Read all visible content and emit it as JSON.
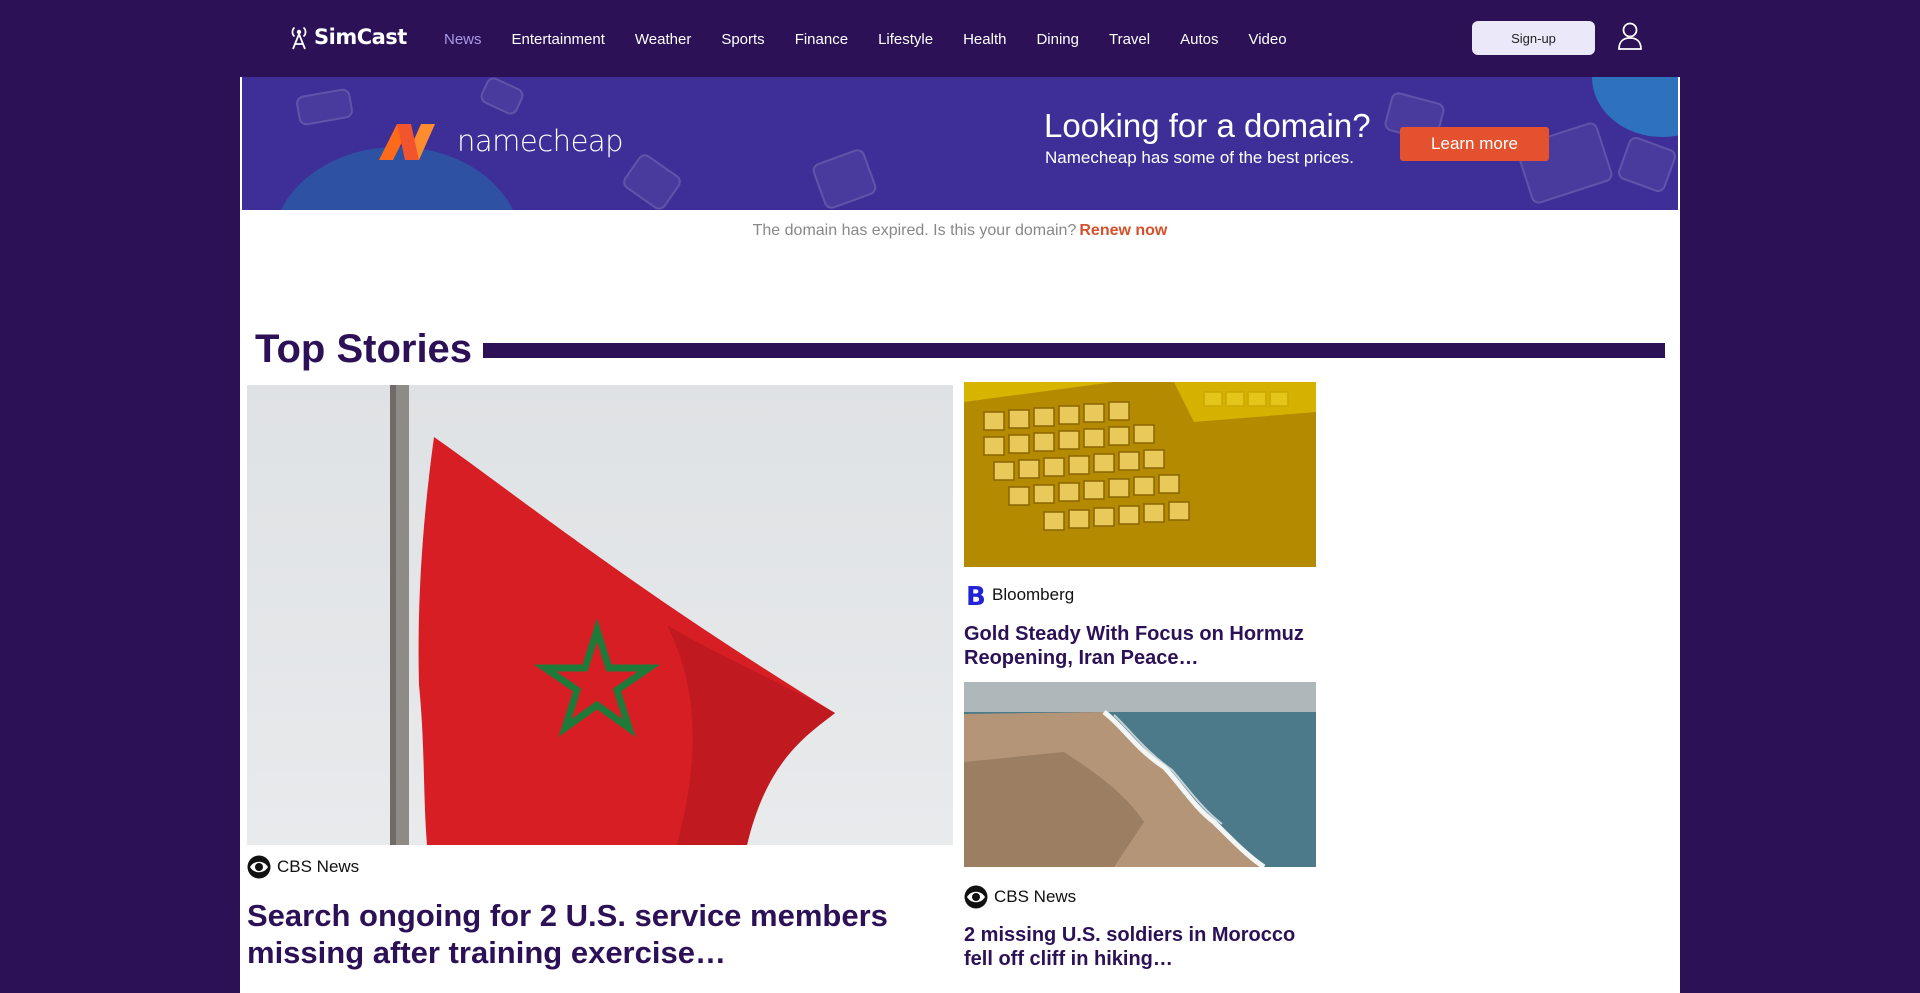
{
  "header": {
    "logo": "SimCast",
    "nav": [
      "News",
      "Entertainment",
      "Weather",
      "Sports",
      "Finance",
      "Lifestyle",
      "Health",
      "Dining",
      "Travel",
      "Autos",
      "Video"
    ],
    "signup_label": "Sign-up"
  },
  "ad": {
    "brand": "namecheap",
    "headline": "Looking for a domain?",
    "subtext": "Namecheap has some of the best prices.",
    "cta": "Learn more"
  },
  "domain_notice": {
    "text": "The domain has expired. Is this your domain?",
    "link": "Renew now"
  },
  "top_stories": {
    "title": "Top Stories",
    "stories": [
      {
        "source": "CBS News",
        "headline": "Search ongoing for 2 U.S. service members missing after training exercise…"
      },
      {
        "source": "Bloomberg",
        "headline": "Gold Steady With Focus on Hormuz Reopening, Iran Peace…"
      },
      {
        "source": "CBS News",
        "headline": "2 missing U.S. soldiers in Morocco fell off cliff in hiking…"
      }
    ]
  },
  "colors": {
    "background": "#2c1157",
    "nav_active": "#a99ae6",
    "ad_background": "#3e2f98",
    "cta": "#e4512e",
    "renew_link": "#d6502b"
  }
}
